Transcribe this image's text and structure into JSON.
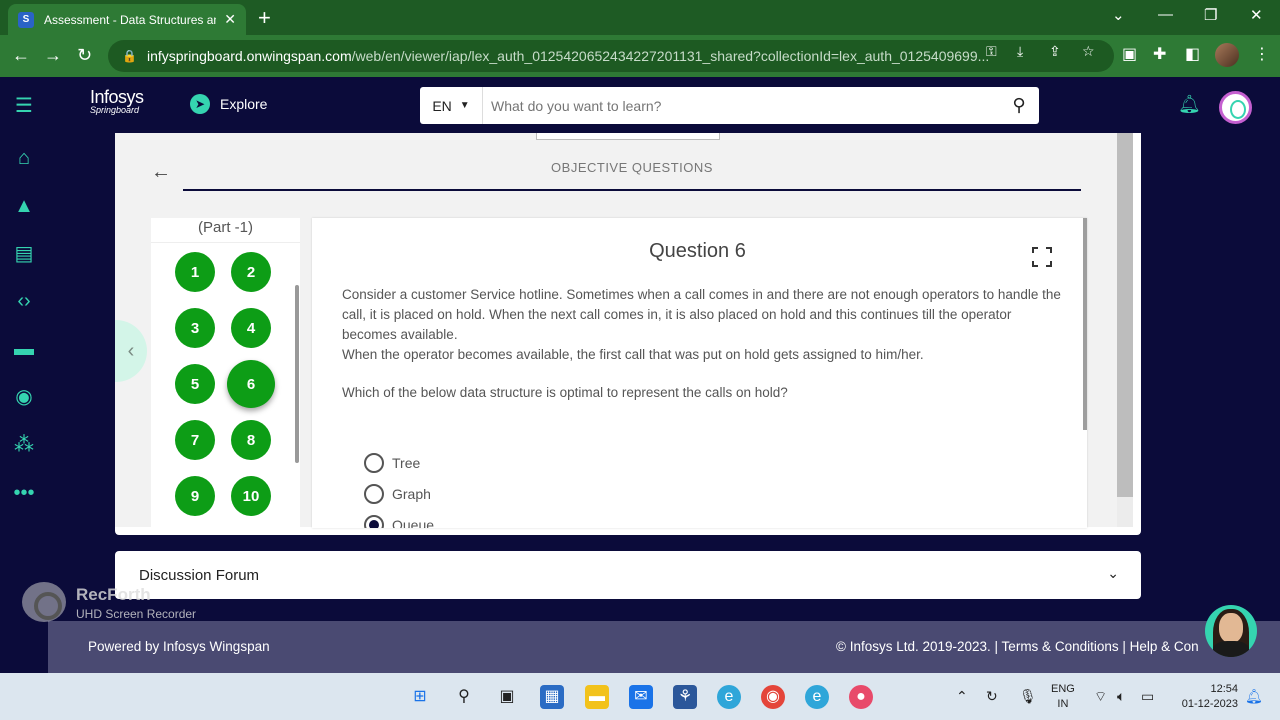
{
  "browser": {
    "tab_title": "Assessment - Data Structures an",
    "tab_favicon": "S",
    "url_host": "infyspringboard.onwingspan.com",
    "url_rest": "/web/en/viewer/iap/lex_auth_012542065243422720113​1_shared?collectionId=lex_auth_0125409699..."
  },
  "header": {
    "logo_line1": "Infosys",
    "logo_line2": "Springboard",
    "explore_label": "Explore",
    "language": "EN",
    "search_placeholder": "What do you want to learn?"
  },
  "assessment": {
    "section_title": "OBJECTIVE QUESTIONS",
    "part_label": "(Part -1)",
    "question_numbers": [
      "1",
      "2",
      "3",
      "4",
      "5",
      "6",
      "7",
      "8",
      "9",
      "10"
    ],
    "active_question": "6",
    "question_title": "Question 6",
    "question_paragraph_1": "Consider a customer Service hotline. Sometimes when a call comes in and there are not enough operators to handle the call, it is placed on hold. When the next call comes in, it is also placed on hold and this continues till the operator becomes available.",
    "question_paragraph_2": "When the operator becomes available, the first call that was put on hold gets assigned to him/her.",
    "question_prompt": "Which of the below data structure is optimal to represent the calls on hold?",
    "options": [
      "Tree",
      "Graph",
      "Queue"
    ],
    "selected_option": "Queue"
  },
  "forum": {
    "label": "Discussion Forum"
  },
  "recorder": {
    "title": "RecForth",
    "subtitle": "UHD Screen Recorder"
  },
  "footer": {
    "powered_by": "Powered by Infosys Wingspan",
    "copyright": "© Infosys Ltd. 2019-2023. | Terms & Conditions | Help & Con"
  },
  "taskbar": {
    "lang_line1": "ENG",
    "lang_line2": "IN",
    "time": "12:54",
    "date": "01-12-2023"
  },
  "colors": {
    "browser_green": "#2e7a35",
    "site_navy": "#0b0b3a",
    "accent_teal": "#35d4b0",
    "question_green": "#0d9d16",
    "footer_bg": "#4a4a72"
  },
  "icons": {
    "rail": [
      "menu-icon",
      "home-icon",
      "navigate-icon",
      "badge-icon",
      "code-icon",
      "chat-icon",
      "target-icon",
      "community-icon",
      "more-icon"
    ]
  }
}
